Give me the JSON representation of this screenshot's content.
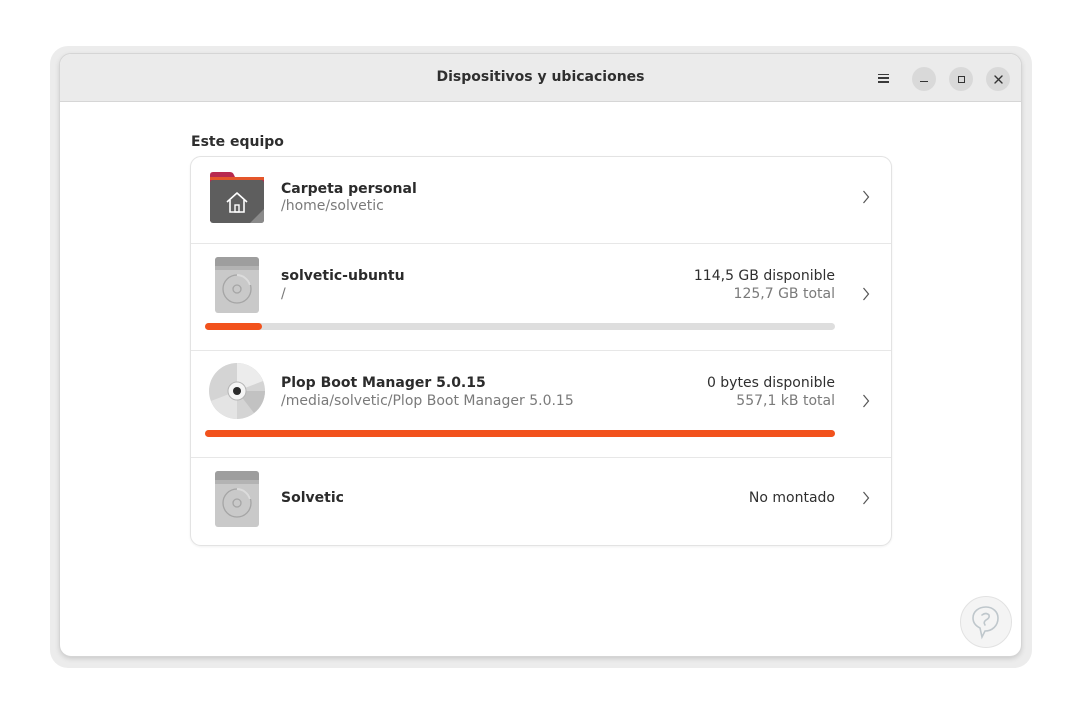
{
  "window": {
    "title": "Dispositivos y ubicaciones"
  },
  "headerbar": {
    "icons": [
      "menu-icon",
      "minimize-icon",
      "maximize-icon",
      "close-icon"
    ]
  },
  "section": {
    "label": "Este equipo"
  },
  "locations": [
    {
      "name": "Carpeta personal",
      "path": "/home/solvetic",
      "icon": "home-folder-icon"
    },
    {
      "name": "solvetic-ubuntu",
      "path": "/",
      "available": "114,5 GB disponible",
      "total": "125,7 GB total",
      "usage_fraction": 0.09,
      "icon": "hard-drive-icon"
    },
    {
      "name": "Plop Boot Manager 5.0.15",
      "path": "/media/solvetic/Plop Boot Manager 5.0.15",
      "available": "0 bytes disponible",
      "total": "557,1 kB total",
      "usage_fraction": 1.0,
      "icon": "optical-disc-icon"
    },
    {
      "name": "Solvetic",
      "status": "No montado",
      "icon": "hard-drive-icon"
    }
  ],
  "colors": {
    "accent": "#f2521c",
    "folder_tab": "#b8294f",
    "folder_body": "#5e5e5e",
    "track": "#dedede"
  }
}
